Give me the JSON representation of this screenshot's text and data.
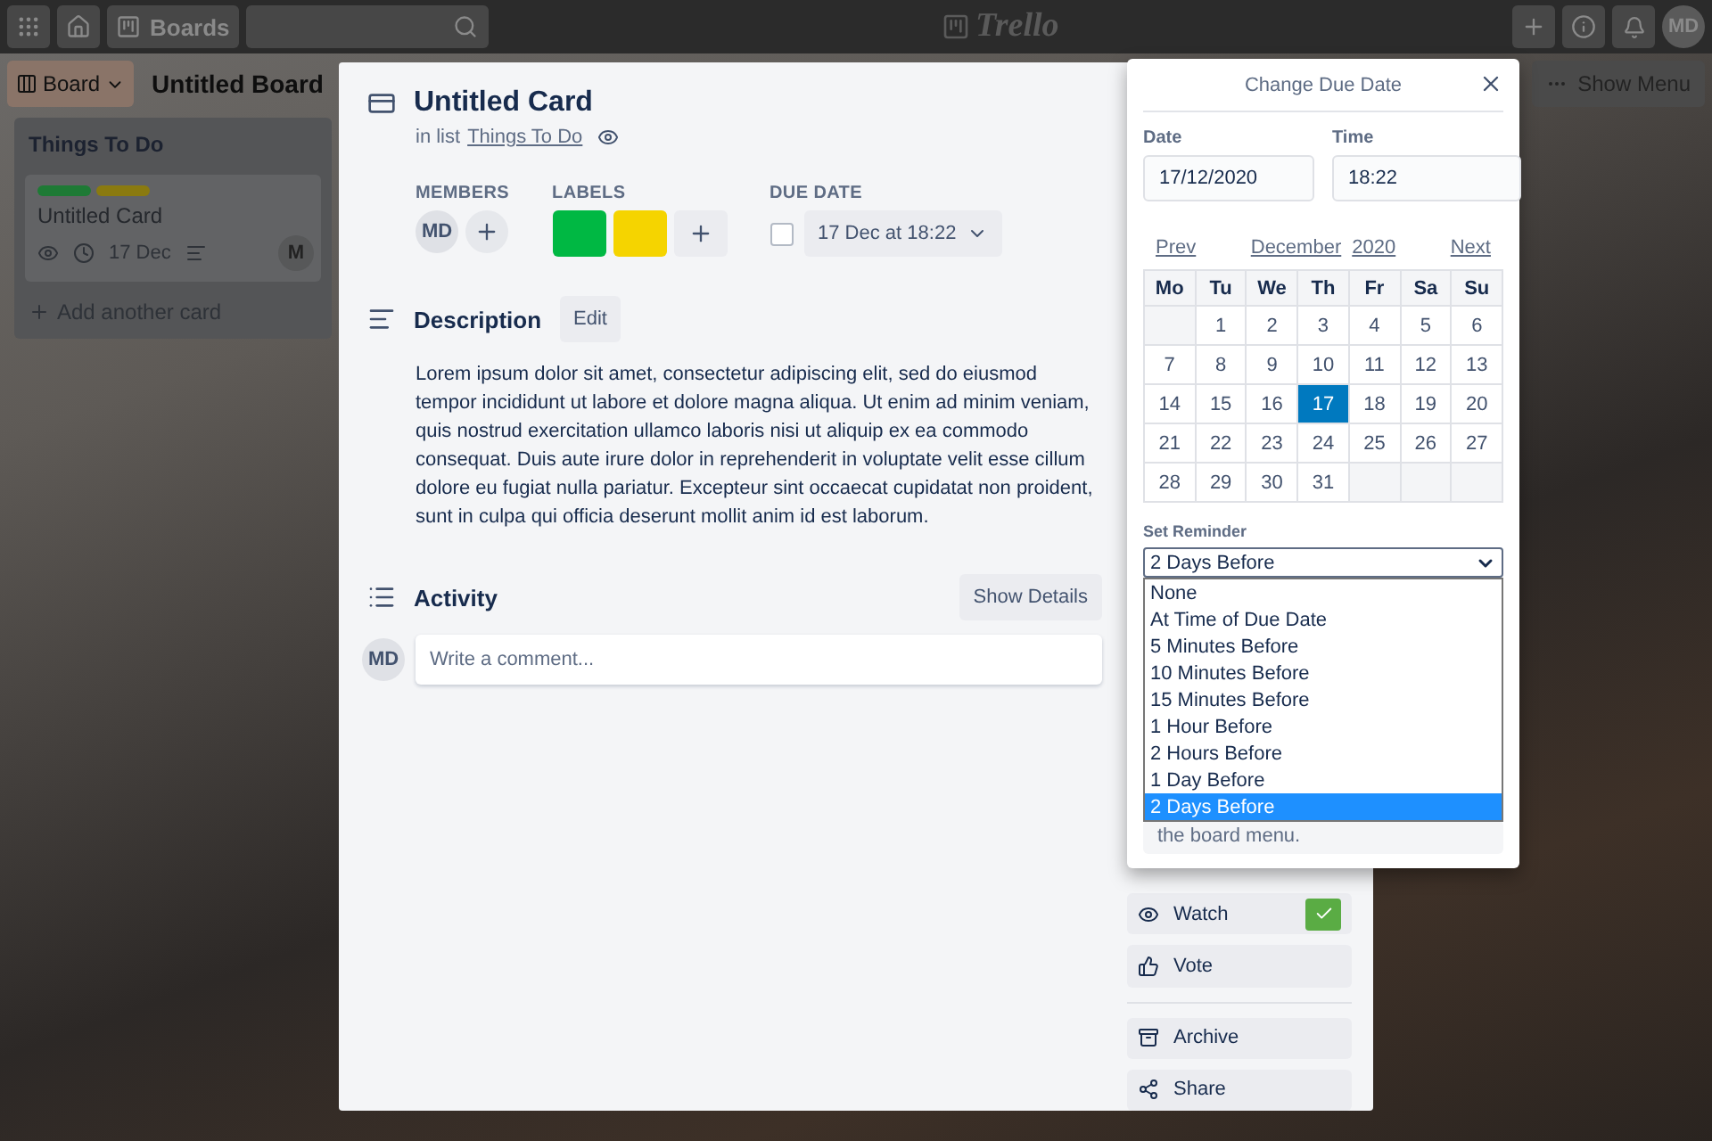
{
  "top_bar": {
    "boards_button": "Boards",
    "logo": "Trello",
    "avatar": "MD"
  },
  "board": {
    "view_button": "Board",
    "title": "Untitled Board",
    "menu_button": "Show Menu"
  },
  "list": {
    "title": "Things To Do",
    "card": {
      "labels": [
        {
          "color": "#1e7a35"
        },
        {
          "color": "#8a7a10"
        }
      ],
      "title": "Untitled Card",
      "due": "17 Dec",
      "member": "M"
    },
    "add_card": "Add another card"
  },
  "card_modal": {
    "title": "Untitled Card",
    "list_prefix": "in list",
    "list_name": "Things To Do",
    "members_heading": "MEMBERS",
    "members": [
      "MD"
    ],
    "labels_heading": "LABELS",
    "labels": [
      {
        "color": "#00b843"
      },
      {
        "color": "#f5d400"
      }
    ],
    "due_heading": "DUE DATE",
    "due_complete": false,
    "due": "17 Dec at 18:22",
    "description_heading": "Description",
    "edit_button": "Edit",
    "description": "Lorem ipsum dolor sit amet, consectetur adipiscing elit, sed do eiusmod tempor incididunt ut labore et dolore magna aliqua. Ut enim ad minim veniam, quis nostrud exercitation ullamco laboris nisi ut aliquip ex ea commodo consequat. Duis aute irure dolor in reprehenderit in voluptate velit esse cillum dolore eu fugiat nulla pariatur. Excepteur sint occaecat cupidatat non proident, sunt in culpa qui officia deserunt mollit anim id est laborum.",
    "activity_heading": "Activity",
    "details_button": "Show Details",
    "comment_avatar": "MD",
    "comment_placeholder": "Write a comment...",
    "sidebar": [
      {
        "kind": "watch",
        "label": "Watch",
        "checked": true
      },
      {
        "kind": "vote",
        "label": "Vote"
      },
      {
        "kind": "archive",
        "label": "Archive"
      },
      {
        "kind": "share",
        "label": "Share"
      }
    ]
  },
  "due_popover": {
    "title": "Change Due Date",
    "date_label": "Date",
    "date": "17/12/2020",
    "time_label": "Time",
    "time": "18:22",
    "prev": "Prev",
    "month": "December",
    "year": "2020",
    "next": "Next",
    "weekdays": [
      "Mo",
      "Tu",
      "We",
      "Th",
      "Fr",
      "Sa",
      "Su"
    ],
    "weeks": [
      [
        {
          "kind": "blank"
        },
        {
          "day": "1",
          "selected": false
        },
        {
          "day": "2",
          "selected": false
        },
        {
          "day": "3",
          "selected": false
        },
        {
          "day": "4",
          "selected": false
        },
        {
          "day": "5",
          "selected": false
        },
        {
          "day": "6",
          "selected": false
        }
      ],
      [
        {
          "day": "7",
          "selected": false
        },
        {
          "day": "8",
          "selected": false
        },
        {
          "day": "9",
          "selected": false
        },
        {
          "day": "10",
          "selected": false
        },
        {
          "day": "11",
          "selected": false
        },
        {
          "day": "12",
          "selected": false
        },
        {
          "day": "13",
          "selected": false
        }
      ],
      [
        {
          "day": "14",
          "selected": false
        },
        {
          "day": "15",
          "selected": false
        },
        {
          "day": "16",
          "selected": false
        },
        {
          "day": "17",
          "selected": true
        },
        {
          "day": "18",
          "selected": false
        },
        {
          "day": "19",
          "selected": false
        },
        {
          "day": "20",
          "selected": false
        }
      ],
      [
        {
          "day": "21",
          "selected": false
        },
        {
          "day": "22",
          "selected": false
        },
        {
          "day": "23",
          "selected": false
        },
        {
          "day": "24",
          "selected": false
        },
        {
          "day": "25",
          "selected": false
        },
        {
          "day": "26",
          "selected": false
        },
        {
          "day": "27",
          "selected": false
        }
      ],
      [
        {
          "day": "28",
          "selected": false
        },
        {
          "day": "29",
          "selected": false
        },
        {
          "day": "30",
          "selected": false
        },
        {
          "day": "31",
          "selected": false
        },
        {
          "kind": "blank"
        },
        {
          "kind": "blank"
        },
        {
          "kind": "blank"
        }
      ]
    ],
    "reminder_label": "Set Reminder",
    "reminder": "2 Days Before",
    "reminder_options": [
      {
        "label": "None",
        "selected": false
      },
      {
        "label": "At Time of Due Date",
        "selected": false
      },
      {
        "label": "5 Minutes Before",
        "selected": false
      },
      {
        "label": "10 Minutes Before",
        "selected": false
      },
      {
        "label": "15 Minutes Before",
        "selected": false
      },
      {
        "label": "1 Hour Before",
        "selected": false
      },
      {
        "label": "2 Hours Before",
        "selected": false
      },
      {
        "label": "1 Day Before",
        "selected": false
      },
      {
        "label": "2 Days Before",
        "selected": true
      }
    ],
    "note": "the board menu."
  }
}
